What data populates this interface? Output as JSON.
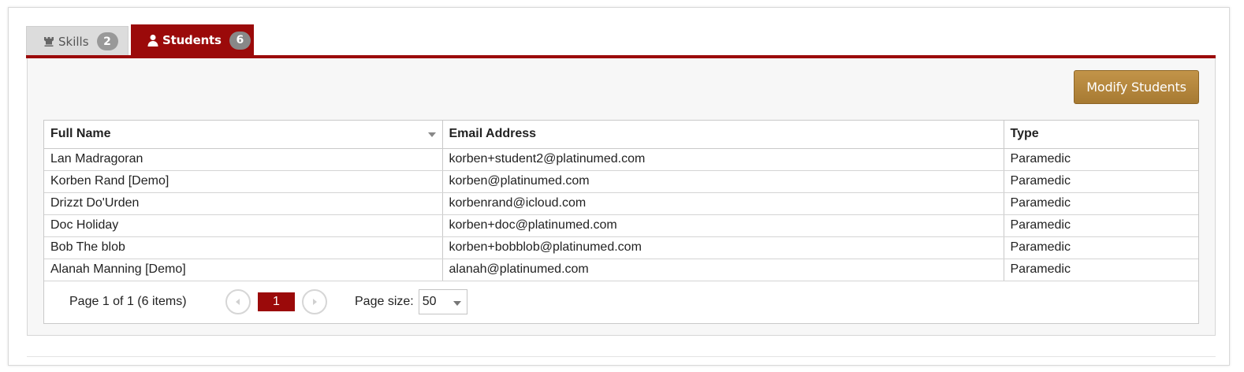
{
  "tabs": [
    {
      "label": "Skills",
      "count": "2",
      "icon": "chess-rook-icon",
      "active": false
    },
    {
      "label": "Students",
      "count": "6",
      "icon": "user-icon",
      "active": true
    }
  ],
  "toolbar": {
    "modify_label": "Modify Students"
  },
  "table": {
    "columns": [
      "Full Name",
      "Email Address",
      "Type"
    ],
    "rows": [
      [
        "Lan Madragoran",
        "korben+student2@platinumed.com",
        "Paramedic"
      ],
      [
        "Korben Rand [Demo]",
        "korben@platinumed.com",
        "Paramedic"
      ],
      [
        "Drizzt Do'Urden",
        "korbenrand@icloud.com",
        "Paramedic"
      ],
      [
        "Doc Holiday",
        "korben+doc@platinumed.com",
        "Paramedic"
      ],
      [
        "Bob The blob",
        "korben+bobblob@platinumed.com",
        "Paramedic"
      ],
      [
        "Alanah Manning [Demo]",
        "alanah@platinumed.com",
        "Paramedic"
      ]
    ]
  },
  "pager": {
    "info": "Page 1 of 1 (6 items)",
    "current_page": "1",
    "page_size_label": "Page size:",
    "page_size": "50"
  },
  "colors": {
    "accent": "#9b0a0a",
    "button": "#b2843c"
  }
}
